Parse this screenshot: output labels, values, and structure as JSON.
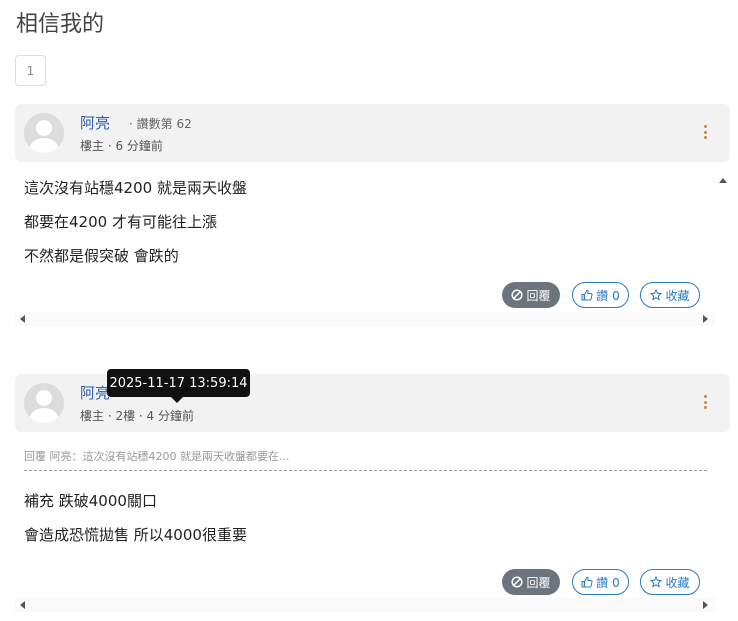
{
  "page": {
    "title": "相信我的"
  },
  "pagination": {
    "current": "1"
  },
  "posts": [
    {
      "author": "阿亮",
      "floor_info": "· 讚數第 62",
      "meta": "樓主 ·  6 分鐘前",
      "lines": [
        "這次沒有站穩4200 就是兩天收盤",
        "都要在4200 才有可能往上漲",
        "不然都是假突破 會跌的"
      ],
      "reply_label": "回覆",
      "like_label": "讚 0",
      "fav_label": "收藏"
    },
    {
      "author": "阿亮",
      "meta": "樓主 · 2樓 ·  4 分鐘前",
      "quote": "回覆 阿亮：這次沒有站穩4200 就是兩天收盤都要在...",
      "lines": [
        "補充 跌破4000關口",
        "會造成恐慌拋售 所以4000很重要"
      ],
      "reply_label": "回覆",
      "like_label": "讚 0",
      "fav_label": "收藏"
    }
  ],
  "tooltip": {
    "text": "2025-11-17 13:59:14"
  },
  "colors": {
    "author": "#2f5fa8",
    "accent": "#2b7bc0",
    "reply_bg": "#6c757d",
    "kebab": "#c8893a"
  },
  "icons": {
    "reply": "ban-icon",
    "like": "thumbs-up-icon",
    "fav": "star-icon",
    "menu": "kebab-icon"
  }
}
